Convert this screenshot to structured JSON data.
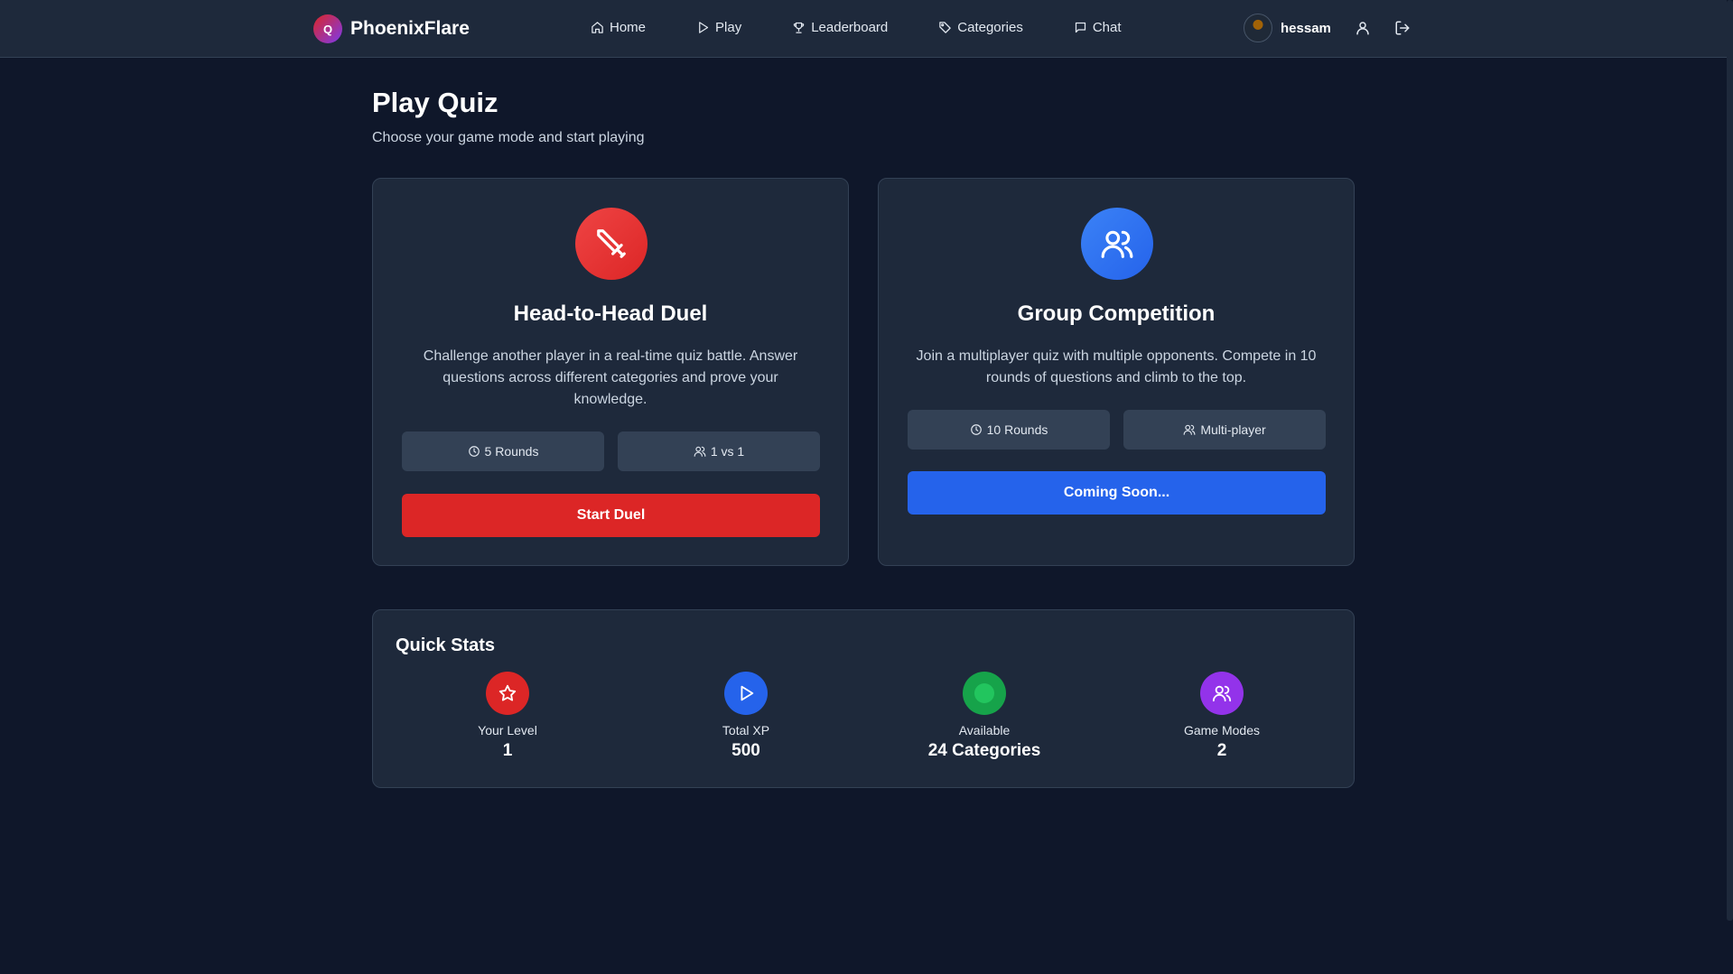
{
  "nav": {
    "brand_logo_letter": "Q",
    "brand_name": "PhoenixFlare",
    "links": [
      {
        "label": "Home",
        "icon": "home-icon"
      },
      {
        "label": "Play",
        "icon": "play-icon"
      },
      {
        "label": "Leaderboard",
        "icon": "trophy-icon"
      },
      {
        "label": "Categories",
        "icon": "tag-icon"
      },
      {
        "label": "Chat",
        "icon": "chat-icon"
      }
    ],
    "username": "hessam"
  },
  "header": {
    "title": "Play Quiz",
    "subtitle": "Choose your game mode and start playing"
  },
  "modes": {
    "duel": {
      "icon": "sword-icon",
      "title": "Head-to-Head Duel",
      "description": "Challenge another player in a real-time quiz battle. Answer questions across different categories and prove your knowledge.",
      "rounds": "5 Rounds",
      "players": "1 vs 1",
      "button": "Start Duel",
      "accent": "#dc2626"
    },
    "group": {
      "icon": "users-icon",
      "title": "Group Competition",
      "description": "Join a multiplayer quiz with multiple opponents. Compete in 10 rounds of questions and climb to the top.",
      "rounds": "10 Rounds",
      "players": "Multi-player",
      "button": "Coming Soon...",
      "accent": "#2563eb"
    }
  },
  "stats": {
    "title": "Quick Stats",
    "items": [
      {
        "label": "Your Level",
        "value": "1",
        "icon": "star-icon",
        "color": "#dc2626"
      },
      {
        "label": "Total XP",
        "value": "500",
        "icon": "play-icon",
        "color": "#2563eb"
      },
      {
        "label": "Available",
        "value": "24 Categories",
        "icon": "dot-icon",
        "color": "#16a34a"
      },
      {
        "label": "Game Modes",
        "value": "2",
        "icon": "users-icon",
        "color": "#9333ea"
      }
    ]
  }
}
